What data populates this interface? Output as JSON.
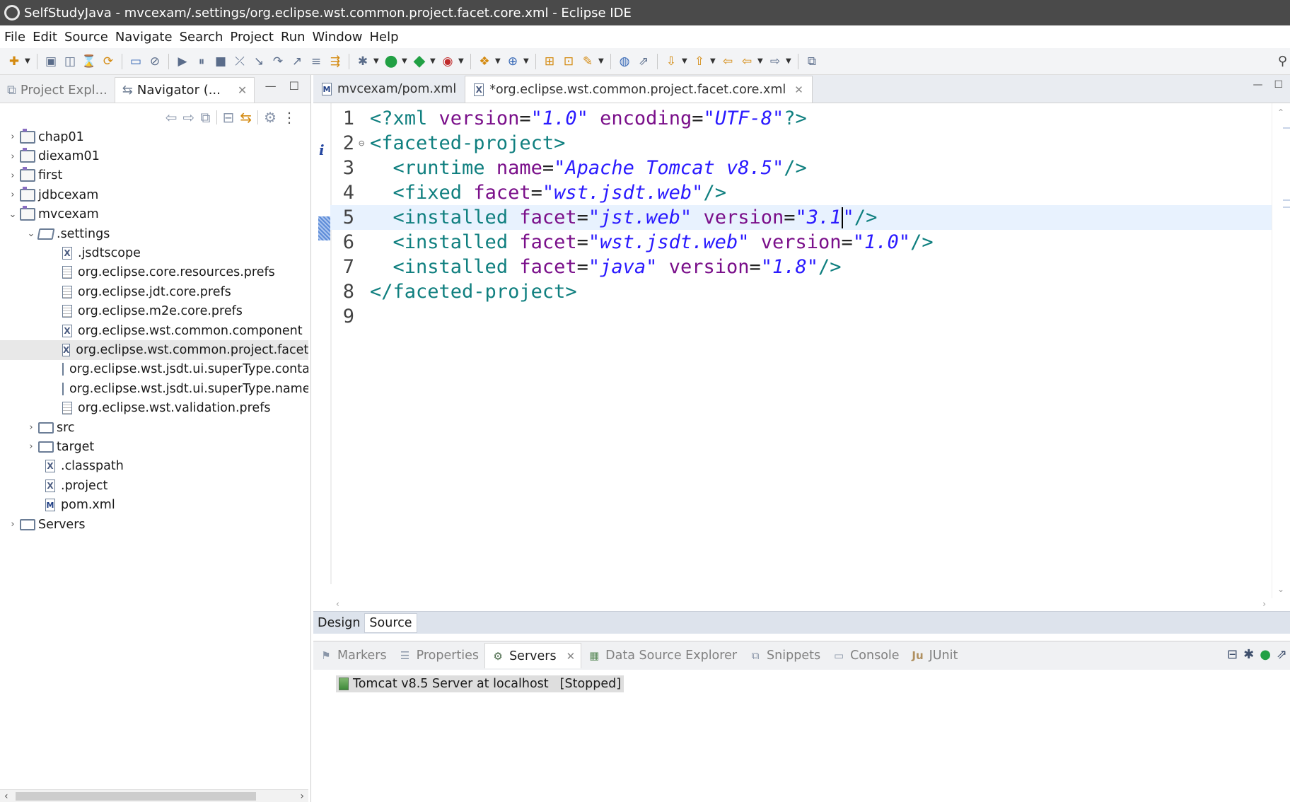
{
  "window": {
    "title": "SelfStudyJava - mvcexam/.settings/org.eclipse.wst.common.project.facet.core.xml - Eclipse IDE"
  },
  "menu": [
    "File",
    "Edit",
    "Source",
    "Navigate",
    "Search",
    "Project",
    "Run",
    "Window",
    "Help"
  ],
  "left_panel": {
    "tabs": [
      {
        "label": "Project Expl...",
        "icon": "project-explorer-icon"
      },
      {
        "label": "Navigator (...",
        "icon": "navigator-icon"
      }
    ],
    "tree": [
      {
        "label": "chap01",
        "type": "project",
        "depth": 0,
        "expanded": false
      },
      {
        "label": "diexam01",
        "type": "project",
        "depth": 0,
        "expanded": false
      },
      {
        "label": "first",
        "type": "project",
        "depth": 0,
        "expanded": false
      },
      {
        "label": "jdbcexam",
        "type": "project",
        "depth": 0,
        "expanded": false
      },
      {
        "label": "mvcexam",
        "type": "project",
        "depth": 0,
        "expanded": true
      },
      {
        "label": ".settings",
        "type": "folder",
        "depth": 1,
        "expanded": true
      },
      {
        "label": ".jsdtscope",
        "type": "xml",
        "depth": 2
      },
      {
        "label": "org.eclipse.core.resources.prefs",
        "type": "file",
        "depth": 2
      },
      {
        "label": "org.eclipse.jdt.core.prefs",
        "type": "file",
        "depth": 2
      },
      {
        "label": "org.eclipse.m2e.core.prefs",
        "type": "file",
        "depth": 2
      },
      {
        "label": "org.eclipse.wst.common.component",
        "type": "xml",
        "depth": 2
      },
      {
        "label": "org.eclipse.wst.common.project.facet.core.xml",
        "type": "xml",
        "depth": 2,
        "selected": true
      },
      {
        "label": "org.eclipse.wst.jsdt.ui.superType.container",
        "type": "file",
        "depth": 2
      },
      {
        "label": "org.eclipse.wst.jsdt.ui.superType.name",
        "type": "file",
        "depth": 2
      },
      {
        "label": "org.eclipse.wst.validation.prefs",
        "type": "file",
        "depth": 2
      },
      {
        "label": "src",
        "type": "folder",
        "depth": 1,
        "expanded": false
      },
      {
        "label": "target",
        "type": "folder",
        "depth": 1,
        "expanded": false
      },
      {
        "label": ".classpath",
        "type": "xml",
        "depth": 1
      },
      {
        "label": ".project",
        "type": "xml",
        "depth": 1
      },
      {
        "label": "pom.xml",
        "type": "maven",
        "depth": 1
      },
      {
        "label": "Servers",
        "type": "folder",
        "depth": 0,
        "expanded": false
      }
    ]
  },
  "editor": {
    "tabs": [
      {
        "label": "mvcexam/pom.xml",
        "icon": "maven-file-icon",
        "active": false
      },
      {
        "label": "*org.eclipse.wst.common.project.facet.core.xml",
        "icon": "xml-file-icon",
        "active": true
      }
    ],
    "current_line": 5,
    "lines": [
      {
        "num": "1",
        "tokens": [
          {
            "t": "tag",
            "v": "<?xml "
          },
          {
            "t": "attr",
            "v": "version"
          },
          {
            "t": "eq",
            "v": "="
          },
          {
            "t": "str",
            "v": "\"1.0\""
          },
          {
            "t": "eq",
            "v": " "
          },
          {
            "t": "attr",
            "v": "encoding"
          },
          {
            "t": "eq",
            "v": "="
          },
          {
            "t": "str",
            "v": "\"UTF-8\""
          },
          {
            "t": "tag",
            "v": "?>"
          }
        ]
      },
      {
        "num": "2",
        "fold": "⊖",
        "tokens": [
          {
            "t": "tag",
            "v": "<faceted-project>"
          }
        ]
      },
      {
        "num": "3",
        "tokens": [
          {
            "t": "eq",
            "v": "  "
          },
          {
            "t": "tag",
            "v": "<runtime "
          },
          {
            "t": "attr",
            "v": "name"
          },
          {
            "t": "eq",
            "v": "="
          },
          {
            "t": "str",
            "v": "\"Apache Tomcat v8.5\""
          },
          {
            "t": "tag",
            "v": "/>"
          }
        ]
      },
      {
        "num": "4",
        "tokens": [
          {
            "t": "eq",
            "v": "  "
          },
          {
            "t": "tag",
            "v": "<fixed "
          },
          {
            "t": "attr",
            "v": "facet"
          },
          {
            "t": "eq",
            "v": "="
          },
          {
            "t": "str",
            "v": "\"wst.jsdt.web\""
          },
          {
            "t": "tag",
            "v": "/>"
          }
        ]
      },
      {
        "num": "5",
        "tokens": [
          {
            "t": "eq",
            "v": "  "
          },
          {
            "t": "tag",
            "v": "<installed "
          },
          {
            "t": "attr",
            "v": "facet"
          },
          {
            "t": "eq",
            "v": "="
          },
          {
            "t": "str",
            "v": "\"jst.web\""
          },
          {
            "t": "eq",
            "v": " "
          },
          {
            "t": "attr",
            "v": "version"
          },
          {
            "t": "eq",
            "v": "="
          },
          {
            "t": "str",
            "v": "\"3.1"
          },
          {
            "t": "caret",
            "v": ""
          },
          {
            "t": "str",
            "v": "\""
          },
          {
            "t": "tag",
            "v": "/>"
          }
        ]
      },
      {
        "num": "6",
        "tokens": [
          {
            "t": "eq",
            "v": "  "
          },
          {
            "t": "tag",
            "v": "<installed "
          },
          {
            "t": "attr",
            "v": "facet"
          },
          {
            "t": "eq",
            "v": "="
          },
          {
            "t": "str",
            "v": "\"wst.jsdt.web\""
          },
          {
            "t": "eq",
            "v": " "
          },
          {
            "t": "attr",
            "v": "version"
          },
          {
            "t": "eq",
            "v": "="
          },
          {
            "t": "str",
            "v": "\"1.0\""
          },
          {
            "t": "tag",
            "v": "/>"
          }
        ]
      },
      {
        "num": "7",
        "tokens": [
          {
            "t": "eq",
            "v": "  "
          },
          {
            "t": "tag",
            "v": "<installed "
          },
          {
            "t": "attr",
            "v": "facet"
          },
          {
            "t": "eq",
            "v": "="
          },
          {
            "t": "str",
            "v": "\"java\""
          },
          {
            "t": "eq",
            "v": " "
          },
          {
            "t": "attr",
            "v": "version"
          },
          {
            "t": "eq",
            "v": "="
          },
          {
            "t": "str",
            "v": "\"1.8\""
          },
          {
            "t": "tag",
            "v": "/>"
          }
        ]
      },
      {
        "num": "8",
        "tokens": [
          {
            "t": "tag",
            "v": "</faceted-project>"
          }
        ]
      },
      {
        "num": "9",
        "tokens": []
      }
    ],
    "bottom_tabs": [
      {
        "label": "Design",
        "active": false
      },
      {
        "label": "Source",
        "active": true
      }
    ]
  },
  "bottom_panel": {
    "tabs": [
      {
        "label": "Markers",
        "icon": "markers-icon",
        "active": false
      },
      {
        "label": "Properties",
        "icon": "properties-icon",
        "active": false
      },
      {
        "label": "Servers",
        "icon": "servers-icon",
        "active": true
      },
      {
        "label": "Data Source Explorer",
        "icon": "data-source-icon",
        "active": false
      },
      {
        "label": "Snippets",
        "icon": "snippets-icon",
        "active": false
      },
      {
        "label": "Console",
        "icon": "console-icon",
        "active": false
      },
      {
        "label": "JUnit",
        "icon": "junit-icon",
        "active": false
      }
    ],
    "server": {
      "name": "Tomcat v8.5 Server at localhost",
      "status": "[Stopped]"
    }
  },
  "colors": {
    "tag": "#0f7f7f",
    "attr": "#7a0f8a",
    "string": "#2a1aff",
    "current_line": "#e8f2fe",
    "titlebar": "#4a4a4a"
  }
}
